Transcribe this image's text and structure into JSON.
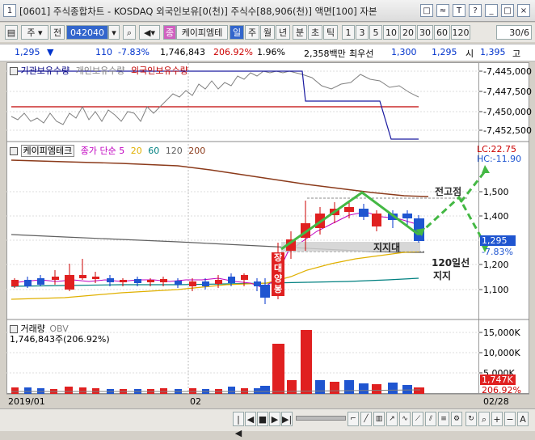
{
  "window": {
    "title": "[0601] 주식종합차트 - KOSDAQ 외국인보유[0(천)] 주식수[88,906(천)] 액면[100] 자본",
    "title_icon": "1",
    "controls": [
      "□",
      "≈",
      "T",
      "?",
      "_",
      "□",
      "×"
    ]
  },
  "toolbar": {
    "market_sel": "주",
    "prev": "전",
    "code": "042040",
    "stock_name": "케이피엠테",
    "period_buttons": [
      "일",
      "주",
      "월",
      "년",
      "분",
      "초",
      "틱"
    ],
    "active_period": "일",
    "intervals": [
      "1",
      "3",
      "5",
      "10",
      "20",
      "30",
      "60",
      "120"
    ],
    "count": "30/6",
    "tag": "종"
  },
  "quote": {
    "price": "1,295",
    "arrow": "▼",
    "change": "110",
    "change_pct": "-7.83%",
    "volume": "1,746,843",
    "vol_ratio": "206.92%",
    "turnover": "1.96%",
    "amount": "2,358백만",
    "best_sell_label": "최우선",
    "bid": "1,300",
    "ask": "1,295",
    "open_label": "시",
    "open": "1,395",
    "high_label": "고"
  },
  "investor_panel": {
    "legend": [
      "기관보유수량",
      "개인보유수량",
      "외국인보유수량"
    ],
    "legend_colors": [
      "#000080",
      "#808080",
      "#c00000"
    ],
    "y_labels": [
      "-7,445,000",
      "-7,447,500",
      "-7,450,000",
      "-7,452,500"
    ]
  },
  "price_panel": {
    "stock_label": "케이피엠테크",
    "ma_title": "종가 단순",
    "ma_periods": [
      "5",
      "20",
      "60",
      "120",
      "200"
    ],
    "ma_colors": [
      "#c000c0",
      "#e0b000",
      "#008080",
      "#606060",
      "#8b3a1a"
    ],
    "lc": "LC:22.75",
    "hc": "HC:-11.90",
    "y_labels": [
      "1,500",
      "1,400",
      "1,300",
      "1,200",
      "1,100"
    ],
    "current_price": "1,295",
    "current_pct": "-7.83%",
    "annotations": {
      "prev_high": "전고점",
      "support_zone": "지지대",
      "ma120_support_line1": "120일선",
      "ma120_support_line2": "지지",
      "long_candle": "장대양봉"
    }
  },
  "volume_panel": {
    "title": "거래량",
    "obv": "OBV",
    "value_line": "1,746,843주(206.92%)",
    "y_labels": [
      "15,000K",
      "10,000K",
      "5,000K"
    ],
    "current_vol": "1,747K",
    "current_pct": "206.92%"
  },
  "x_axis": {
    "start": "2019/01",
    "mid": "02",
    "end": "02/28"
  },
  "bottom_controls": [
    "|◀",
    "◀",
    "■",
    "▶",
    "▶|",
    "+",
    "−",
    "A"
  ]
}
